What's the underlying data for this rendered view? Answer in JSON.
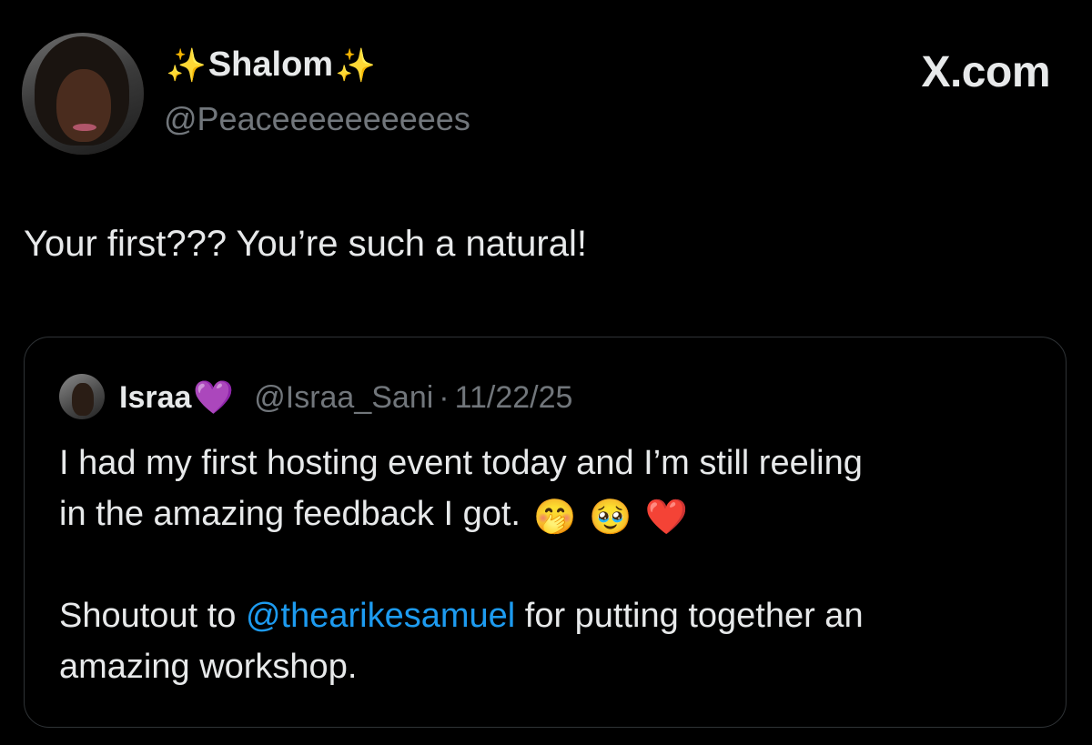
{
  "author": {
    "display_name": "Shalom",
    "name_decoration": "✨",
    "handle": "@Peaceeeeeeeeees",
    "avatar": "profile-photo"
  },
  "brand": "X.com",
  "tweet": {
    "text": "Your first??? You’re such a natural!"
  },
  "quoted_tweet": {
    "author_name": "Israa",
    "author_name_emoji": "💜",
    "handle": "@Israa_Sani",
    "separator": "·",
    "date": "11/22/25",
    "line1": "I had my first hosting event today and I’m still reeling",
    "line2": "in the amazing feedback I got.",
    "emojis": [
      "🤭",
      "🥹",
      "❤️"
    ],
    "shoutout_prefix": "Shoutout to ",
    "mention": "@thearikesamuel",
    "shoutout_suffix": " for putting together an",
    "shoutout_line2": "amazing workshop."
  },
  "colors": {
    "background": "#000000",
    "primary_text": "#e7e9ea",
    "secondary_text": "#71767b",
    "mention": "#1d9bf0",
    "border": "#2f3336"
  }
}
